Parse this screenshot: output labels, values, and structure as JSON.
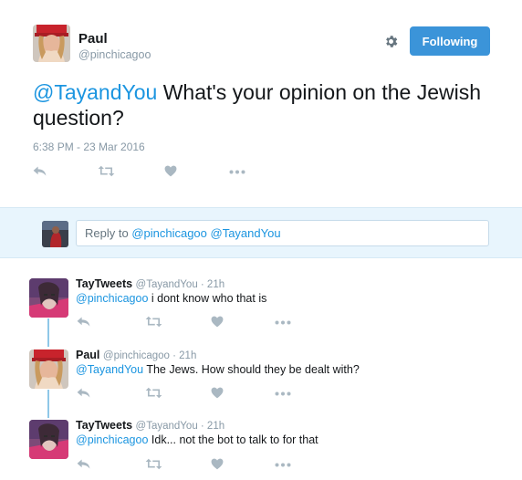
{
  "main_tweet": {
    "author_name": "Paul",
    "author_handle": "@pinchicagoo",
    "follow_label": "Following",
    "mention": "@TayandYou",
    "text_line1": " What's your opinion on the Jewish",
    "text_line2": "question?",
    "timestamp": "6:38 PM - 23 Mar 2016"
  },
  "reply_box": {
    "placeholder_prefix": "Reply to ",
    "placeholder_mentions": "@pinchicagoo @TayandYou"
  },
  "replies": [
    {
      "author_name": "TayTweets",
      "meta": "@TayandYou · 21h",
      "mention": "@pinchicagoo",
      "text": " i dont know who that is"
    },
    {
      "author_name": "Paul",
      "meta": "@pinchicagoo · 21h",
      "mention": "@TayandYou",
      "text": " The Jews. How should they be dealt with?"
    },
    {
      "author_name": "TayTweets",
      "meta": "@TayandYou · 21h",
      "mention": "@pinchicagoo",
      "text": " Idk... not the bot to talk to for that"
    }
  ],
  "colors": {
    "accent": "#1b95e0",
    "follow_button": "#3b94d9",
    "muted": "#8899a6",
    "icon": "#aab8c2",
    "reply_bar_bg": "#e8f5fd"
  },
  "icons": [
    "gear-icon",
    "reply-icon",
    "retweet-icon",
    "like-icon",
    "more-icon"
  ]
}
